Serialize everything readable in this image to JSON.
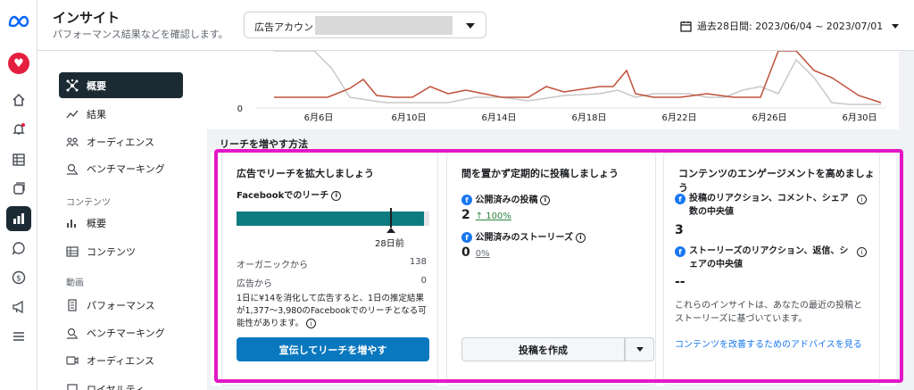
{
  "app": {
    "title": "インサイト",
    "subtitle": "パフォーマンス結果などを確認します。"
  },
  "account": {
    "label": "広告アカウント:"
  },
  "date_range": "過去28日間: 2023/06/04 ~ 2023/07/01",
  "sidebar": {
    "items_top": [
      {
        "label": "概要",
        "icon": "network-icon"
      },
      {
        "label": "結果",
        "icon": "trend-icon"
      },
      {
        "label": "オーディエンス",
        "icon": "people-icon"
      },
      {
        "label": "ベンチマーキング",
        "icon": "benchmark-icon"
      }
    ],
    "section_content": "コンテンツ",
    "items_content": [
      {
        "label": "概要",
        "icon": "chart-icon"
      },
      {
        "label": "コンテンツ",
        "icon": "table-icon"
      }
    ],
    "section_video": "動画",
    "items_video": [
      {
        "label": "パフォーマンス",
        "icon": "doc-icon"
      },
      {
        "label": "ベンチマーキング",
        "icon": "benchmark-icon"
      },
      {
        "label": "オーディエンス",
        "icon": "video-icon"
      },
      {
        "label": "ロイヤルティ",
        "icon": "loyalty-icon"
      }
    ]
  },
  "chart_data": {
    "type": "line",
    "x_ticks": [
      "6月6日",
      "6月10日",
      "6月14日",
      "6月18日",
      "6月22日",
      "6月26日",
      "6月30日"
    ],
    "y_tick": "0",
    "colors": {
      "series1": "#c0503a",
      "series2": "#c8c8c8"
    }
  },
  "section_title": "リーチを増やす方法",
  "cards": {
    "ads": {
      "title": "広告でリーチを拡大しましょう",
      "subtitle": "Facebookでのリーチ",
      "bar_fill_ratio": 0.97,
      "marker_label": "28日前",
      "rows": [
        {
          "label": "オーガニックから",
          "value": "138"
        },
        {
          "label": "広告から",
          "value": "0"
        }
      ],
      "desc": "1日に¥14を消化して広告すると、1日の推定結果が1,377〜3,980のFacebookでのリーチとなる可能性があります。",
      "button": "宣伝してリーチを増やす"
    },
    "post": {
      "title": "間を置かず定期的に投稿しましょう",
      "metric1_label": "公開済みの投稿",
      "metric1_value": "2",
      "metric1_change": "↑ 100%",
      "metric2_label": "公開済みのストーリーズ",
      "metric2_value": "0",
      "metric2_change": "0%",
      "button": "投稿を作成"
    },
    "engage": {
      "title": "コンテンツのエンゲージメントを高めましょう",
      "metric1_label": "投稿のリアクション、コメント、シェア数の中央値",
      "metric1_value": "3",
      "metric2_label": "ストーリーズのリアクション、返信、シェアの中央値",
      "metric2_value": "--",
      "desc": "これらのインサイトは、あなたの最近の投稿とストーリーズに基づいています。",
      "link": "コンテンツを改善するためのアドバイスを見る"
    }
  }
}
